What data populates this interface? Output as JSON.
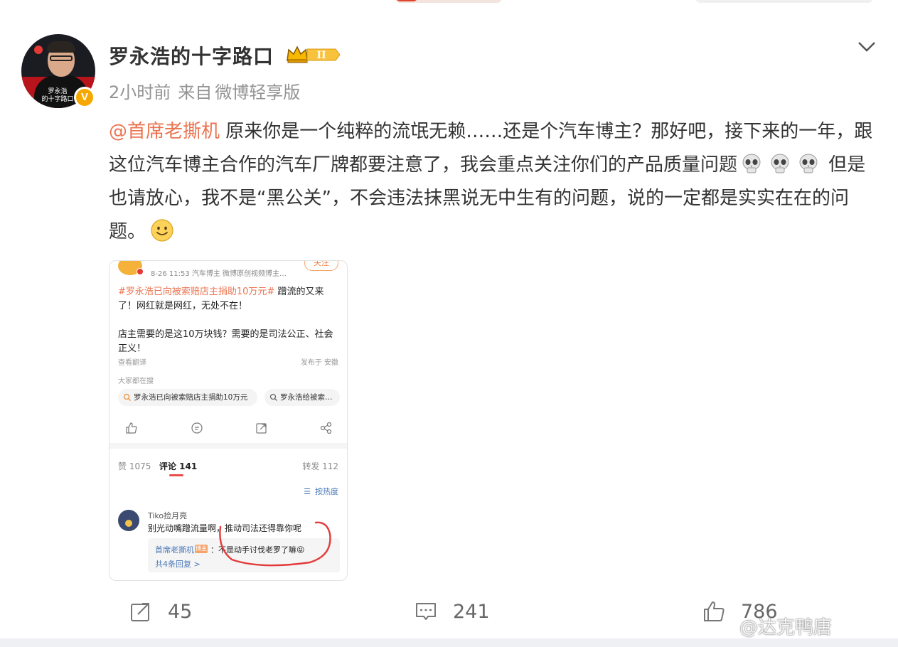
{
  "post": {
    "author": "罗永浩的十字路口",
    "avatar_caption": "罗永浩\n的十字路口",
    "verified_badge": "V",
    "level_badge": "II",
    "time": "2小时前",
    "source_prefix": "来自",
    "source": "微博轻享版",
    "mention": "@首席老撕机",
    "text_1": " 原来你是一个纯粹的流氓无赖……还是个汽车博主？那好吧，接下来的一年，跟这位汽车博主合作的汽车厂牌都要注意了，我会重点关注你们的产品质量问题",
    "emoji_skull_count": 3,
    "text_2": " 但是也请放心，我不是“黑公关”，不会违法抹黑说无中生有的问题，说的一定都是实实在在的问题。",
    "emoji_end": "smile"
  },
  "embedded_screenshot": {
    "meta": "8-26 11:53  汽车博主 微博原创视频博主…",
    "follow": "关注",
    "hashtag": "#罗永浩已向被索赔店主捐助10万元#",
    "body_1": " 蹭流的又来了！网红就是网红，无处不在！",
    "body_2": "店主需要的是这10万块钱？需要的是司法公正、社会正义！",
    "translate": "查看翻译",
    "location": "发布于 安徽",
    "everyone_searching": "大家都在搜",
    "chip_1": "罗永浩已向被索赔店主捐助10万元",
    "chip_2": "罗永浩给被索…",
    "likes_tab": "赞 1075",
    "comments_tab": "评论 141",
    "reposts_tab": "转发 112",
    "sort": "按热度",
    "commenter": "Tiko捡月亮",
    "comment": "别光动嘴蹭流量啊，推动司法还得靠你呢",
    "reply_author": "首席老撕机",
    "reply_tag": "博主",
    "reply_text": "：不是动手讨伐老罗了嘛😝",
    "reply_more": "共4条回复 >"
  },
  "actions": {
    "repost_count": "45",
    "comment_count": "241",
    "like_count": "786"
  },
  "watermark": "@达克鸭唐",
  "colors": {
    "mention": "#eb7350",
    "meta_gray": "#939393",
    "link_blue": "#4a78b8",
    "badge_gold": "#f6a800"
  }
}
